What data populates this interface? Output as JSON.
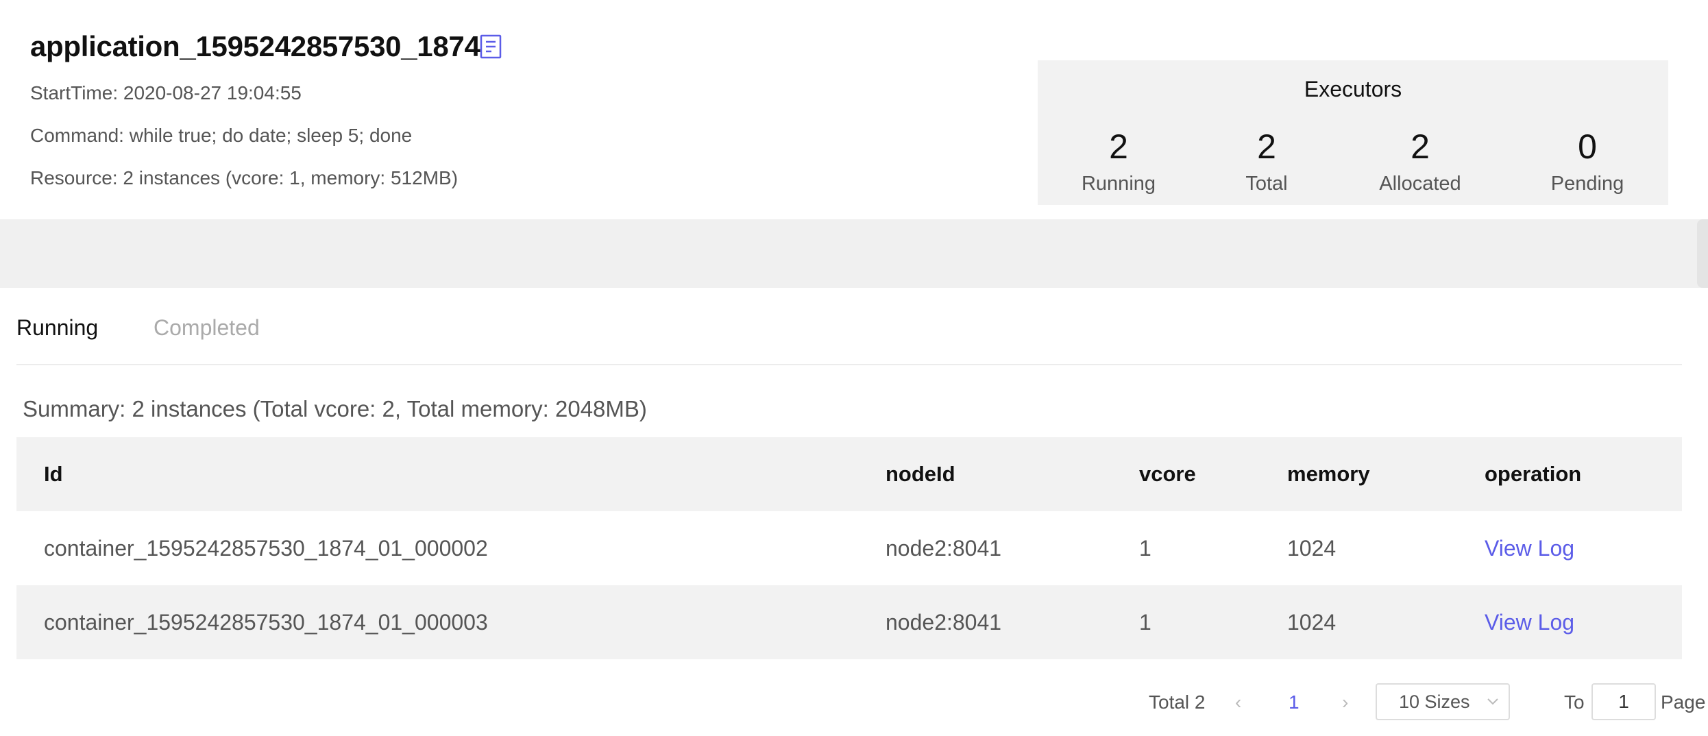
{
  "app": {
    "title": "application_1595242857530_1874",
    "start_time": "StartTime: 2020-08-27 19:04:55",
    "command_label": "Command:",
    "command_value": "while true; do date; sleep 5; done",
    "resource": "Resource: 2 instances (vcore: 1, memory: 512MB)"
  },
  "executors": {
    "title": "Executors",
    "stats": [
      {
        "value": "2",
        "label": "Running"
      },
      {
        "value": "2",
        "label": "Total"
      },
      {
        "value": "2",
        "label": "Allocated"
      },
      {
        "value": "0",
        "label": "Pending"
      }
    ]
  },
  "tabs": [
    {
      "label": "Running",
      "active": true
    },
    {
      "label": "Completed",
      "active": false
    }
  ],
  "summary": "Summary: 2 instances (Total vcore: 2, Total memory: 2048MB)",
  "table": {
    "columns": [
      "Id",
      "nodeId",
      "vcore",
      "memory",
      "operation"
    ],
    "rows": [
      {
        "id": "container_1595242857530_1874_01_000002",
        "nodeId": "node2:8041",
        "vcore": "1",
        "memory": "1024",
        "operation": "View Log"
      },
      {
        "id": "container_1595242857530_1874_01_000003",
        "nodeId": "node2:8041",
        "vcore": "1",
        "memory": "1024",
        "operation": "View Log"
      }
    ]
  },
  "pagination": {
    "total": "Total 2",
    "current_page": "1",
    "page_size": "10 Sizes",
    "goto_label": "To",
    "goto_value": "1",
    "page_label": "Page"
  },
  "colors": {
    "accent": "#5b5ce8",
    "panel": "#f2f2f2"
  },
  "icons": {
    "title_icon": "document-icon",
    "prev": "chevron-left-icon",
    "next": "chevron-right-icon",
    "dropdown": "chevron-down-icon"
  }
}
